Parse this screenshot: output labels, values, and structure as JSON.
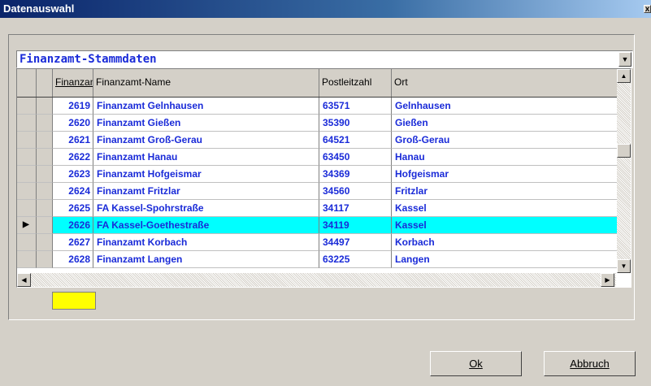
{
  "window": {
    "title": "Datenauswahl",
    "close": "x"
  },
  "combo": {
    "value": "Finanzamt-Stammdaten"
  },
  "columns": [
    "Finanzamt",
    "Finanzamt-Name",
    "Postleitzahl",
    "Ort"
  ],
  "rows": [
    {
      "nr": "2619",
      "name": "Finanzamt Gelnhausen",
      "plz": "63571",
      "ort": "Gelnhausen"
    },
    {
      "nr": "2620",
      "name": "Finanzamt Gießen",
      "plz": "35390",
      "ort": "Gießen"
    },
    {
      "nr": "2621",
      "name": "Finanzamt Groß-Gerau",
      "plz": "64521",
      "ort": "Groß-Gerau"
    },
    {
      "nr": "2622",
      "name": "Finanzamt Hanau",
      "plz": "63450",
      "ort": "Hanau"
    },
    {
      "nr": "2623",
      "name": "Finanzamt Hofgeismar",
      "plz": "34369",
      "ort": "Hofgeismar"
    },
    {
      "nr": "2624",
      "name": "Finanzamt Fritzlar",
      "plz": "34560",
      "ort": "Fritzlar"
    },
    {
      "nr": "2625",
      "name": "FA Kassel-Spohrstraße",
      "plz": "34117",
      "ort": "Kassel"
    },
    {
      "nr": "2626",
      "name": "FA Kassel-Goethestraße",
      "plz": "34119",
      "ort": "Kassel"
    },
    {
      "nr": "2627",
      "name": "Finanzamt Korbach",
      "plz": "34497",
      "ort": "Korbach"
    },
    {
      "nr": "2628",
      "name": "Finanzamt Langen",
      "plz": "63225",
      "ort": "Langen"
    }
  ],
  "selected_row": 7,
  "buttons": {
    "ok": "Ok",
    "cancel": "Abbruch"
  },
  "colors": {
    "text": "#1a2bd8",
    "selection": "#00ffff",
    "edit": "#ffff00"
  }
}
